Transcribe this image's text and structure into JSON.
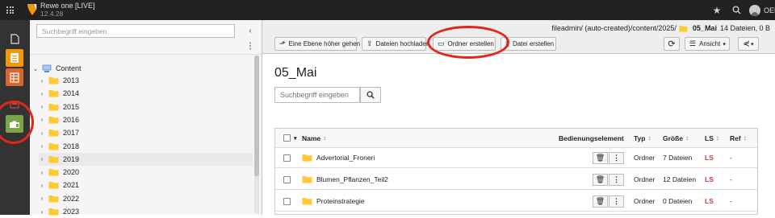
{
  "topbar": {
    "site_name": "Rewe one [LIVE]",
    "version": "12.4.28",
    "user_label": "OED"
  },
  "tree": {
    "search_placeholder": "Suchbegriff eingeben",
    "root_label": "Content",
    "folders": [
      "2013",
      "2014",
      "2015",
      "2016",
      "2017",
      "2018",
      "2019",
      "2020",
      "2021",
      "2022",
      "2023"
    ],
    "selected": "2019"
  },
  "path": {
    "prefix": "fileadmin/ (auto-created)/content/2025/",
    "current": "05_Mai",
    "summary": "14 Dateien, 0 B"
  },
  "toolbar": {
    "up_label": "Eine Ebene höher gehen",
    "upload_label": "Dateien hochladen",
    "new_folder_label": "Ordner erstellen",
    "new_file_label": "Datei erstellen",
    "view_label": "Ansicht"
  },
  "main": {
    "title": "05_Mai",
    "search_placeholder": "Suchbegriff eingeben"
  },
  "table": {
    "headers": {
      "name": "Name",
      "control": "Bedienungselement",
      "type": "Typ",
      "size": "Größe",
      "ls": "LS",
      "ref": "Ref"
    },
    "rows": [
      {
        "name": "Advertorial_Froneri",
        "type": "Ordner",
        "size": "7 Dateien",
        "ls": "LS",
        "ref": "-"
      },
      {
        "name": "Blumen_Pflanzen_Teil2",
        "type": "Ordner",
        "size": "12 Dateien",
        "ls": "LS",
        "ref": "-"
      },
      {
        "name": "Proteinstrategie",
        "type": "Ordner",
        "size": "0 Dateien",
        "ls": "LS",
        "ref": "-"
      }
    ]
  },
  "colors": {
    "topbar": "#222222",
    "module_bar": "#333333",
    "accent_orange": "#f49700",
    "filelist_green": "#79a548",
    "annotation_red": "#e0271b",
    "folder_yellow": "#ffc933",
    "ls_red": "#c83c3c"
  },
  "icons": {
    "app_menu": "grid-icon",
    "logo": "typo3-logo-icon",
    "bookmark": "star-icon",
    "search": "search-icon",
    "user": "avatar-icon"
  }
}
